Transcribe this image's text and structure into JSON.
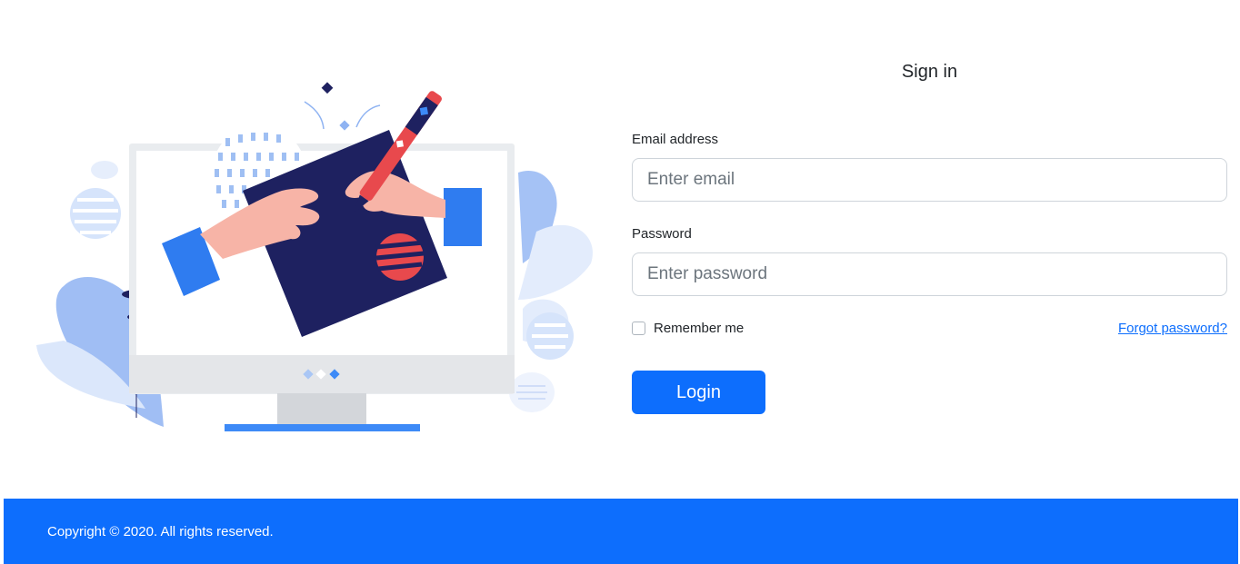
{
  "form": {
    "title": "Sign in",
    "email_label": "Email address",
    "email_placeholder": "Enter email",
    "password_label": "Password",
    "password_placeholder": "Enter password",
    "remember_label": "Remember me",
    "forgot_label": "Forgot password?",
    "login_label": "Login"
  },
  "footer": {
    "copyright": "Copyright © 2020. All rights reserved."
  },
  "colors": {
    "primary": "#0d6efd",
    "navy": "#1e2160",
    "coral": "#e8494d",
    "light_blue": "#a9c6f5"
  }
}
